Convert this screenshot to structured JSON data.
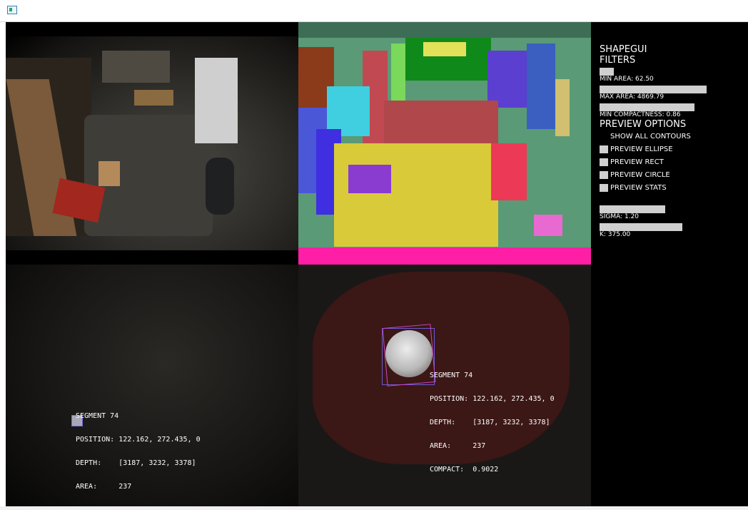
{
  "window": {
    "title": "",
    "icon": "app-window-icon"
  },
  "controls": {
    "title": "SHAPEGUI",
    "filters_heading": "FILTERS",
    "min_area_label": "MIN  AREA:  62.50",
    "min_area_value": 0.02,
    "max_area_label": "MAX  AREA:  4869.79",
    "max_area_value": 1.0,
    "min_compactness_label": "MIN  COMPACTNESS:  0.86",
    "min_compactness_value": 0.86,
    "preview_heading": "PREVIEW  OPTIONS",
    "show_all_contours": "SHOW  ALL  CONTOURS",
    "preview_ellipse": "PREVIEW  ELLIPSE",
    "preview_rect": "PREVIEW  RECT",
    "preview_circle": "PREVIEW  CIRCLE",
    "preview_stats": "PREVIEW  STATS",
    "sigma_label": "SIGMA:  1.20",
    "k_label": "K:  375.00"
  },
  "segment_info": {
    "segment": "SEGMENT 74",
    "position": "POSITION: 122.162, 272.435, 0",
    "depth": "DEPTH:    [3187, 3232, 3378]",
    "area": "AREA:     237",
    "compact": "COMPACT:  0.9022"
  },
  "colors": {
    "background": "#000000",
    "slider": "#cfcfcf",
    "segmentation_magenta": "#ff1fa6"
  }
}
